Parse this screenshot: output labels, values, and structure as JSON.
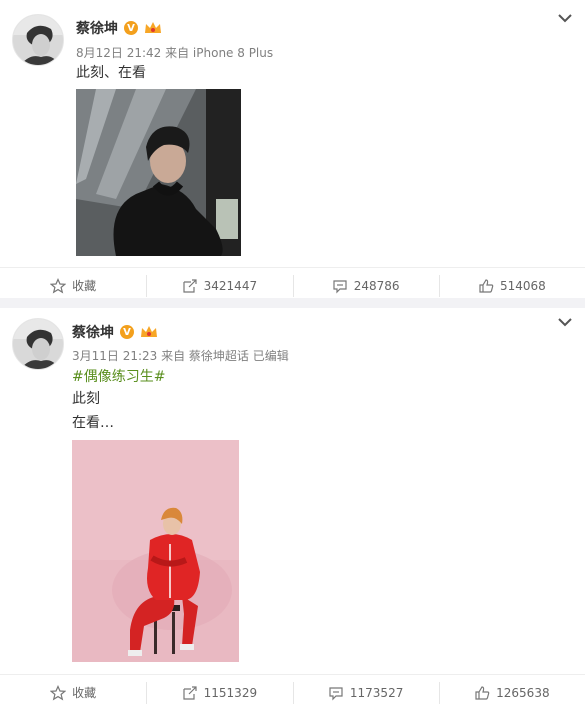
{
  "posts": [
    {
      "username": "蔡徐坤",
      "verified_badge": "V",
      "meta": "8月12日 21:42 来自 iPhone 8 Plus",
      "text": "此刻、在看",
      "actions": {
        "favorite_label": "收藏",
        "repost_count": "3421447",
        "comment_count": "248786",
        "like_count": "514068"
      }
    },
    {
      "username": "蔡徐坤",
      "verified_badge": "V",
      "meta": "3月11日 21:23 来自 蔡徐坤超话   已编辑",
      "hashtag": "#偶像练习生#",
      "text_line1": "此刻",
      "text_line2": "在看…",
      "actions": {
        "favorite_label": "收藏",
        "repost_count": "1151329",
        "comment_count": "1173527",
        "like_count": "1265638"
      }
    }
  ],
  "icons": {
    "favorite": "star-icon",
    "repost": "repost-icon",
    "comment": "comment-icon",
    "like": "thumbs-up-icon",
    "menu": "chevron-down-icon",
    "crown": "crown-icon"
  },
  "colors": {
    "verified": "#f3a01d",
    "hashtag": "#5a8f1e",
    "meta": "#808080"
  }
}
